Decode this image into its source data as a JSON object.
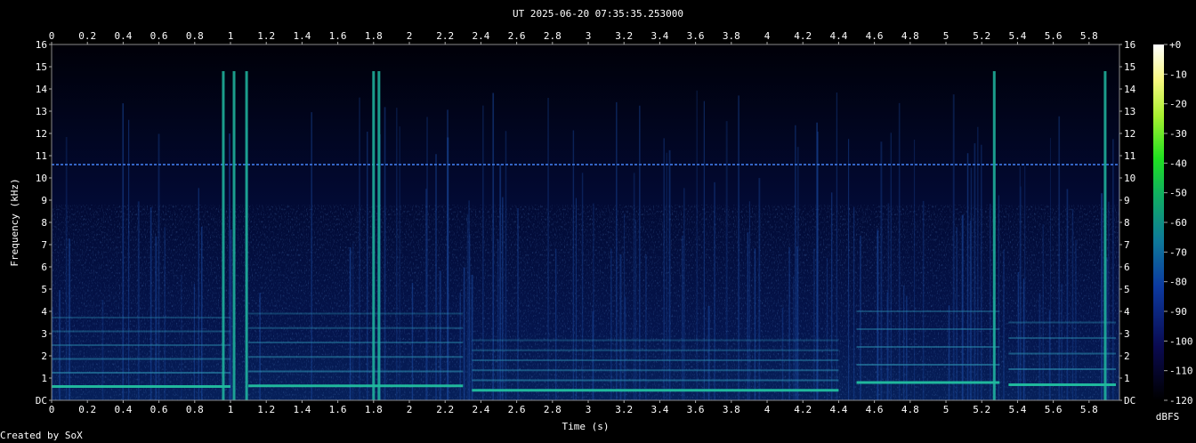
{
  "chart_data": {
    "type": "heatmap",
    "title": "UT 2025-06-20 07:35:35.253000",
    "xlabel": "Time (s)",
    "ylabel": "Frequency (kHz)",
    "xlim": [
      0,
      5.97
    ],
    "ylim": [
      0,
      16
    ],
    "x_ticks": [
      "0",
      "0.2",
      "0.4",
      "0.6",
      "0.8",
      "1",
      "1.2",
      "1.4",
      "1.6",
      "1.8",
      "2",
      "2.2",
      "2.4",
      "2.6",
      "2.8",
      "3",
      "3.2",
      "3.4",
      "3.6",
      "3.8",
      "4",
      "4.2",
      "4.4",
      "4.6",
      "4.8",
      "5",
      "5.2",
      "5.4",
      "5.6",
      "5.8"
    ],
    "y_ticks": [
      "DC",
      "1",
      "2",
      "3",
      "4",
      "5",
      "6",
      "7",
      "8",
      "9",
      "10",
      "11",
      "12",
      "13",
      "14",
      "15",
      "16"
    ],
    "colorbar": {
      "label": "dBFS",
      "ticks": [
        "+0",
        "-10",
        "-20",
        "-30",
        "-40",
        "-50",
        "-60",
        "-70",
        "-80",
        "-90",
        "-100",
        "-110",
        "-120"
      ],
      "range": [
        -120,
        0
      ]
    },
    "features": {
      "steady_tone_khz": 10.6,
      "fundamental_segments": [
        {
          "t": [
            0,
            1.0
          ],
          "khz": 0.62
        },
        {
          "t": [
            1.1,
            2.3
          ],
          "khz": 0.65
        },
        {
          "t": [
            2.35,
            4.4
          ],
          "khz": 0.45
        },
        {
          "t": [
            4.5,
            5.3
          ],
          "khz": 0.8
        },
        {
          "t": [
            5.35,
            5.95
          ],
          "khz": 0.7
        }
      ],
      "strong_transients_s": [
        0.96,
        1.02,
        1.09,
        1.8,
        1.83,
        5.27,
        5.89
      ]
    }
  },
  "footer": {
    "credit": "Created by SoX"
  }
}
